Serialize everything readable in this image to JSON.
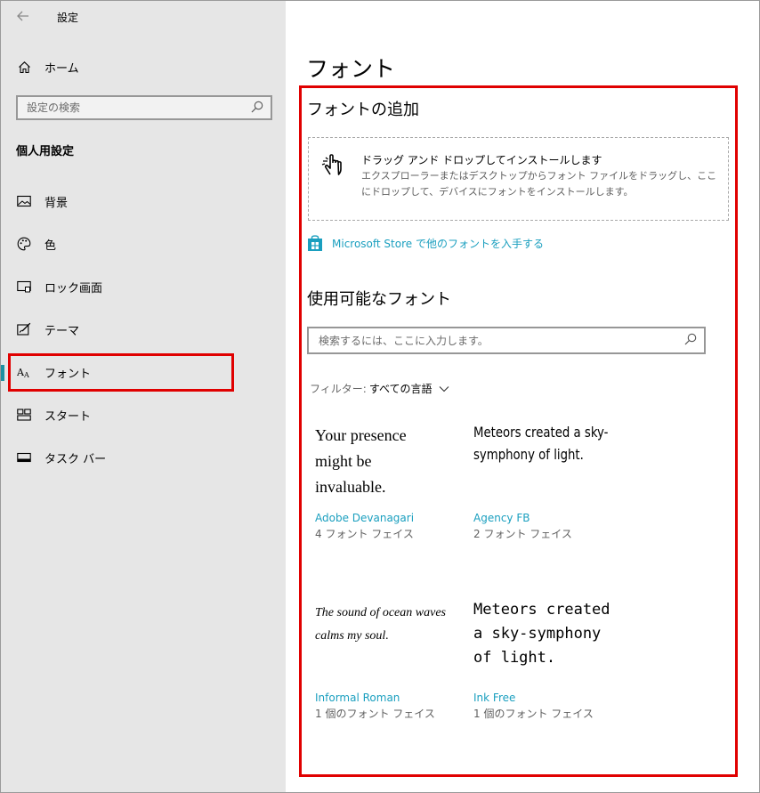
{
  "window": {
    "title": "設定"
  },
  "sidebar": {
    "home_label": "ホーム",
    "search_placeholder": "設定の検索",
    "section_heading": "個人用設定",
    "items": [
      {
        "label": "背景",
        "icon": "picture-icon"
      },
      {
        "label": "色",
        "icon": "palette-icon"
      },
      {
        "label": "ロック画面",
        "icon": "lock-screen-icon"
      },
      {
        "label": "テーマ",
        "icon": "theme-icon"
      },
      {
        "label": "フォント",
        "icon": "fonts-icon",
        "selected": true
      },
      {
        "label": "スタート",
        "icon": "start-icon"
      },
      {
        "label": "タスク バー",
        "icon": "taskbar-icon"
      }
    ]
  },
  "main": {
    "page_title": "フォント",
    "add_heading": "フォントの追加",
    "drop_title": "ドラッグ アンド ドロップしてインストールします",
    "drop_desc": "エクスプローラーまたはデスクトップからフォント ファイルをドラッグし、ここにドロップして、デバイスにフォントをインストールします。",
    "store_link": "Microsoft Store で他のフォントを入手する",
    "available_heading": "使用可能なフォント",
    "search_placeholder": "検索するには、ここに入力します。",
    "filter_label": "フィルター:",
    "filter_value": "すべての言語",
    "fonts": [
      {
        "sample": "Your presence might be invaluable.",
        "name": "Adobe Devanagari",
        "faces": "4 フォント フェイス"
      },
      {
        "sample": "Meteors created a sky-symphony of light.",
        "name": "Agency FB",
        "faces": "2 フォント フェイス"
      },
      {
        "sample": "The sound of ocean waves calms my soul.",
        "name": "Informal Roman",
        "faces": "1 個のフォント フェイス"
      },
      {
        "sample": "Meteors created a sky-symphony of light.",
        "name": "Ink Free",
        "faces": "1 個のフォント フェイス"
      }
    ]
  },
  "colors": {
    "accent": "#1a9fbf",
    "highlight": "#e00000",
    "sidebar_bg": "#e6e6e6"
  }
}
